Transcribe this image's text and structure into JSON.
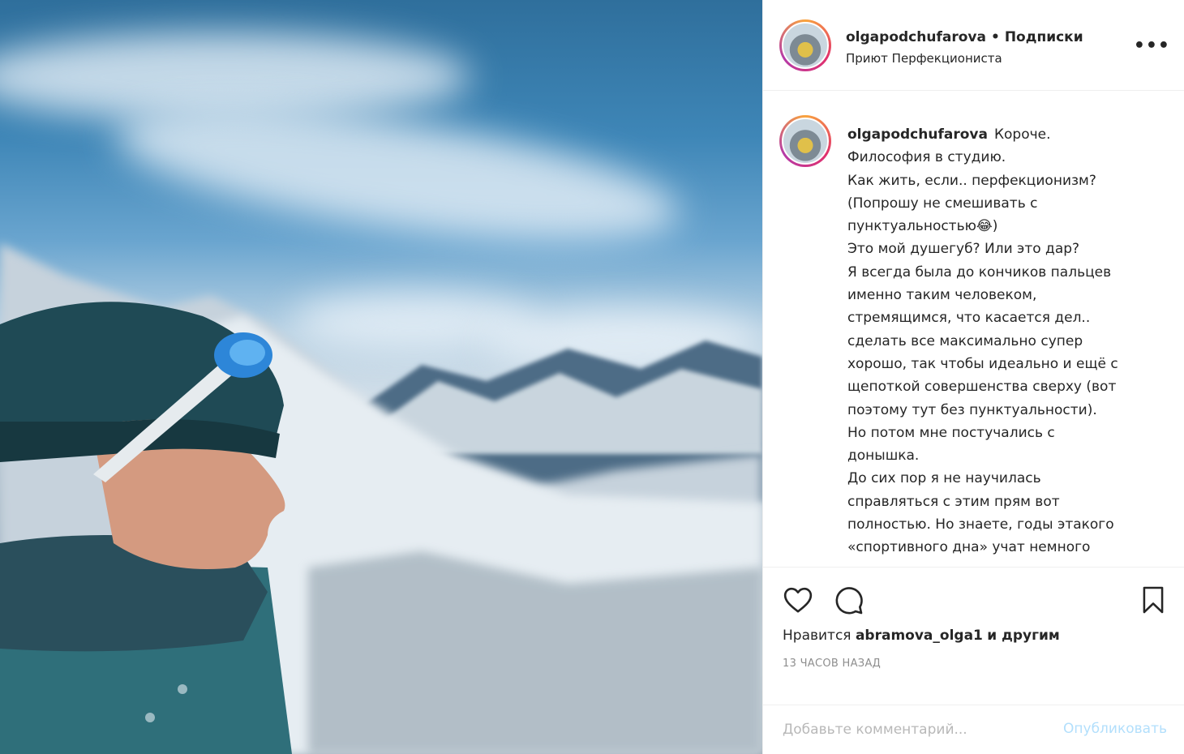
{
  "post": {
    "username": "olgapodchufarova",
    "separator": "•",
    "follow_label": "Подписки",
    "subtitle": "Приют Перфекциониста",
    "more_label": "•••"
  },
  "caption": {
    "username": "olgapodchufarova",
    "lines": [
      "Короче.",
      "Философия в студию.",
      "Как жить, если.. перфекционизм?",
      "(Попрошу не смешивать с",
      "пунктуальностью😂)",
      "Это мой душегуб? Или это дар?",
      "Я всегда была до кончиков пальцев",
      "именно таким человеком,",
      "стремящимся, что касается дел..",
      "сделать все максимально супер",
      "хорошо, так чтобы идеально и ещё с",
      "щепоткой совершенства сверху (вот",
      "поэтому тут без пунктуальности).",
      "Но потом мне постучались с",
      "донышка.",
      "До сих пор я не научилась",
      "справляться с этим прям вот",
      "полностью. Но знаете, годы этакого",
      "«спортивного дна» учат немного"
    ]
  },
  "actions": {
    "like_icon": "heart-icon",
    "comment_icon": "comment-icon",
    "save_icon": "bookmark-icon",
    "likes_prefix": "Нравится",
    "likes_user": "abramova_olga1",
    "likes_suffix": "и другим",
    "time_ago": "13 ЧАСОВ НАЗАД"
  },
  "comment": {
    "placeholder": "Добавьте комментарий...",
    "publish_label": "Опубликовать"
  },
  "colors": {
    "text": "#262626",
    "muted": "#8e8e8e",
    "publish_disabled": "#b2dffc",
    "border": "#efefef"
  }
}
